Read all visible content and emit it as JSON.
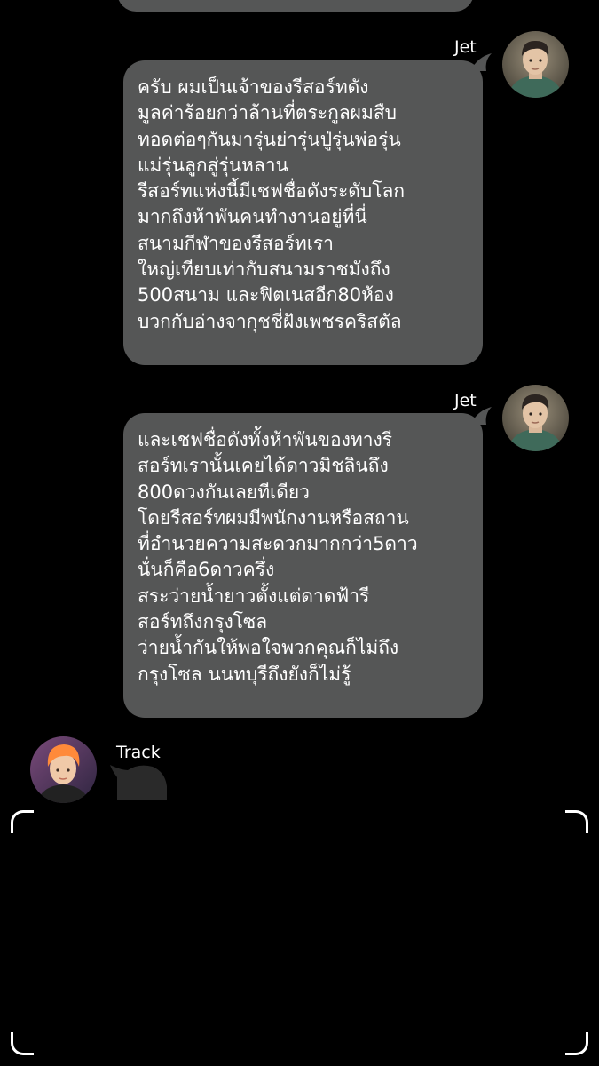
{
  "messages": [
    {
      "sender": "Jet",
      "avatar_icon": "user-avatar-icon",
      "text": "ครับ ผมเป็นเจ้าของรีสอร์ทดัง\nมูลค่าร้อยกว่าล้านที่ตระกูลผมสืบ\nทอดต่อๆกันมารุ่นย่ารุ่นปู่รุ่นพ่อรุ่น\nแม่รุ่นลูกสู่รุ่นหลาน\nรีสอร์ทแห่งนี้มีเชฟชื่อดังระดับโลก\nมากถึงห้าพันคนทำงานอยู่ที่นี่\nสนามกีฬาของรีสอร์ทเรา\nใหญ่เทียบเท่ากับสนามราชมังถึง\n500สนาม และฟิตเนสอีก80ห้อง\nบวกกับอ่างจากุชชี่ฝังเพชรคริสตัล"
    },
    {
      "sender": "Jet",
      "avatar_icon": "user-avatar-icon",
      "text": "และเชฟชื่อดังทั้งห้าพันของทางรี\nสอร์ทเรานั้นเคยได้ดาวมิชลินถึง\n800ดวงกันเลยทีเดียว\nโดยรีสอร์ทผมมีพนักงานหรือสถาน\nที่อำนวยความสะดวกมากกว่า5ดาว\nนั่นก็คือ6ดาวครึ่ง\nสระว่ายน้ำยาวตั้งแต่ดาดฟ้ารี\nสอร์ทถึงกรุงโซล\nว่ายน้ำกันให้พอใจพวกคุณก็ไม่ถึง\nกรุงโซล นนทบุรีถึงยังก็ไม่รู้"
    },
    {
      "sender": "Track",
      "avatar_icon": "user-avatar-icon",
      "text": ""
    }
  ],
  "colors": {
    "background": "#000000",
    "bubble": "#555656",
    "text": "#ffffff"
  },
  "icons": {
    "viewfinder": "viewfinder-corner-icon"
  }
}
